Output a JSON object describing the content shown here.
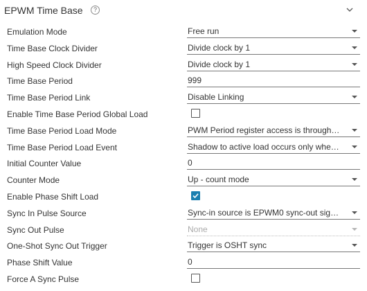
{
  "header": {
    "title": "EPWM Time Base",
    "help_icon": "help-icon",
    "collapse_icon": "chevron-down-icon"
  },
  "fields": [
    {
      "label": "Emulation Mode",
      "type": "select",
      "value": "Free run"
    },
    {
      "label": "Time Base Clock Divider",
      "type": "select",
      "value": "Divide clock by 1"
    },
    {
      "label": "High Speed Clock Divider",
      "type": "select",
      "value": "Divide clock by 1"
    },
    {
      "label": "Time Base Period",
      "type": "text",
      "value": "999"
    },
    {
      "label": "Time Base Period Link",
      "type": "select",
      "value": "Disable Linking"
    },
    {
      "label": "Enable Time Base Period Global Load",
      "type": "checkbox",
      "checked": false
    },
    {
      "label": "Time Base Period Load Mode",
      "type": "select",
      "value": "PWM Period register access is through…"
    },
    {
      "label": "Time Base Period Load Event",
      "type": "select",
      "value": "Shadow to active load occurs only whe…"
    },
    {
      "label": "Initial Counter Value",
      "type": "text",
      "value": "0"
    },
    {
      "label": "Counter Mode",
      "type": "select",
      "value": "Up - count mode"
    },
    {
      "label": "Enable Phase Shift Load",
      "type": "checkbox",
      "checked": true
    },
    {
      "label": "Sync In Pulse Source",
      "type": "select",
      "value": "Sync-in source is EPWM0 sync-out sig…"
    },
    {
      "label": "Sync Out Pulse",
      "type": "select",
      "value": "None",
      "disabled": true
    },
    {
      "label": "One-Shot Sync Out Trigger",
      "type": "select",
      "value": "Trigger is OSHT sync"
    },
    {
      "label": "Phase Shift Value",
      "type": "text",
      "value": "0"
    },
    {
      "label": "Force A Sync Pulse",
      "type": "checkbox",
      "checked": false
    }
  ],
  "colors": {
    "checkbox_checked": "#1a7fb0",
    "text": "#333333",
    "underline": "#777777"
  }
}
